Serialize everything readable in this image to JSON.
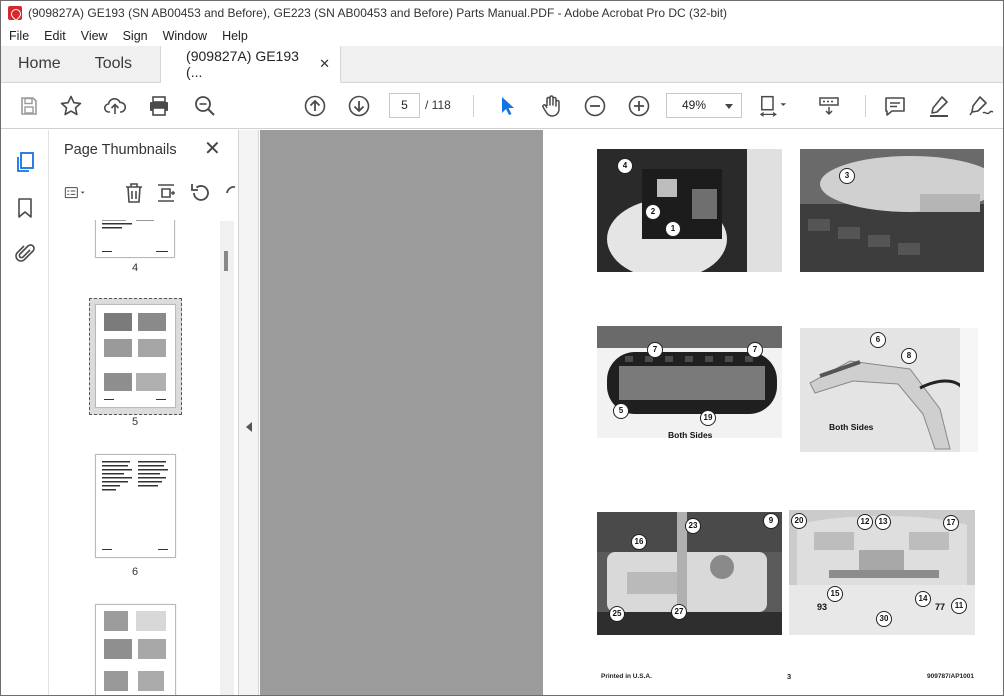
{
  "window": {
    "title": "(909827A) GE193 (SN AB00453 and Before), GE223 (SN AB00453 and Before) Parts Manual.PDF - Adobe Acrobat Pro DC (32-bit)"
  },
  "menu": [
    "File",
    "Edit",
    "View",
    "Sign",
    "Window",
    "Help"
  ],
  "tabs": {
    "home": "Home",
    "tools": "Tools",
    "document": "(909827A) GE193 (...",
    "close": "✕"
  },
  "toolbar": {
    "current_page": "5",
    "page_total": "/ 118",
    "zoom": "49%"
  },
  "thumbnails_panel": {
    "title": "Page Thumbnails",
    "close": "✕",
    "pages": [
      "4",
      "5",
      "6"
    ]
  },
  "document_page": {
    "captions": {
      "both_sides_1": "Both Sides",
      "both_sides_2": "Both Sides",
      "num_93": "93",
      "num_77": "77"
    },
    "callouts": [
      "4",
      "2",
      "1",
      "3",
      "7",
      "7",
      "5",
      "19",
      "6",
      "8",
      "23",
      "9",
      "16",
      "25",
      "27",
      "20",
      "12",
      "13",
      "17",
      "15",
      "14",
      "11",
      "30"
    ],
    "footer_left": "Printed in U.S.A.",
    "footer_center": "3",
    "footer_right": "909787/AP1001"
  },
  "colors": {
    "accent": "#1473e6",
    "acrobat_red": "#d7282f",
    "doc_background": "#9b9b9b"
  }
}
